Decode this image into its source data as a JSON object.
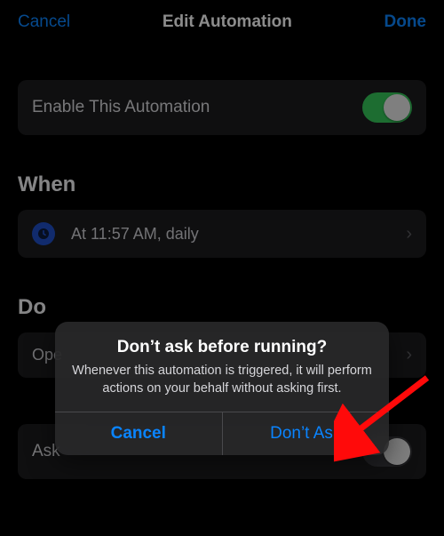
{
  "nav": {
    "cancel": "Cancel",
    "title": "Edit Automation",
    "done": "Done"
  },
  "enable_row": {
    "label": "Enable This Automation",
    "on": true
  },
  "when": {
    "heading": "When",
    "trigger_text": "At 11:57 AM, daily"
  },
  "do": {
    "heading": "Do",
    "action_prefix": "Ope"
  },
  "ask_row": {
    "label_prefix": "Ask",
    "on": false
  },
  "alert": {
    "title": "Don’t ask before running?",
    "message": "Whenever this automation is triggered, it will perform actions on your behalf without asking first.",
    "cancel": "Cancel",
    "confirm": "Don’t Ask"
  }
}
